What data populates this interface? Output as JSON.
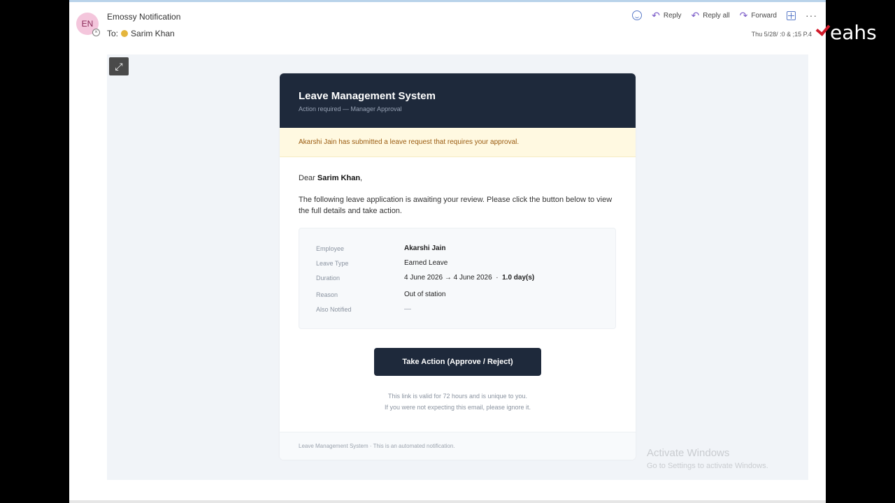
{
  "header": {
    "avatar_initials": "EN",
    "sender_name": "Emossy Notification",
    "to_label": "To:",
    "recipient": "Sarim Khan",
    "timestamp": "Thu 5/28/ :0 &  ;15 P.4"
  },
  "toolbar": {
    "reply_label": "Reply",
    "reply_all_label": "Reply all",
    "forward_label": "Forward",
    "more_label": "···"
  },
  "email": {
    "title": "Leave Management System",
    "subtitle": "Action required — Manager Approval",
    "alert": "Akarshi Jain has submitted a leave request that requires your approval.",
    "greeting_prefix": "Dear",
    "greeting_name": "Sarim Khan",
    "greeting_suffix": ",",
    "paragraph": "The following leave application is awaiting your review. Please click the button below to view the full details and take action.",
    "details": {
      "employee_label": "Employee",
      "employee_value": "Akarshi Jain",
      "leave_type_label": "Leave Type",
      "leave_type_value": "Earned Leave",
      "duration_label": "Duration",
      "duration_range": "4 June 2026 → 4 June 2026",
      "duration_sep": "·",
      "duration_days": "1.0 day(s)",
      "reason_label": "Reason",
      "reason_value": "Out of station",
      "also_notified_label": "Also Notified",
      "also_notified_value": "—"
    },
    "action_button": "Take Action (Approve / Reject)",
    "note_line1": "This link is valid for 72 hours and is unique to you.",
    "note_line2": "If you were not expecting this email, please ignore it.",
    "footer": "Leave Management System  ·  This is an automated notification."
  },
  "watermark": {
    "line1": "Activate Windows",
    "line2": "Go to Settings to activate Windows."
  },
  "brand": {
    "word": "eahs"
  },
  "colors": {
    "header_dark": "#1e293b",
    "alert_bg": "#fff9e1",
    "alert_text": "#9a5b10",
    "accent_icon": "#7a5ac8"
  }
}
